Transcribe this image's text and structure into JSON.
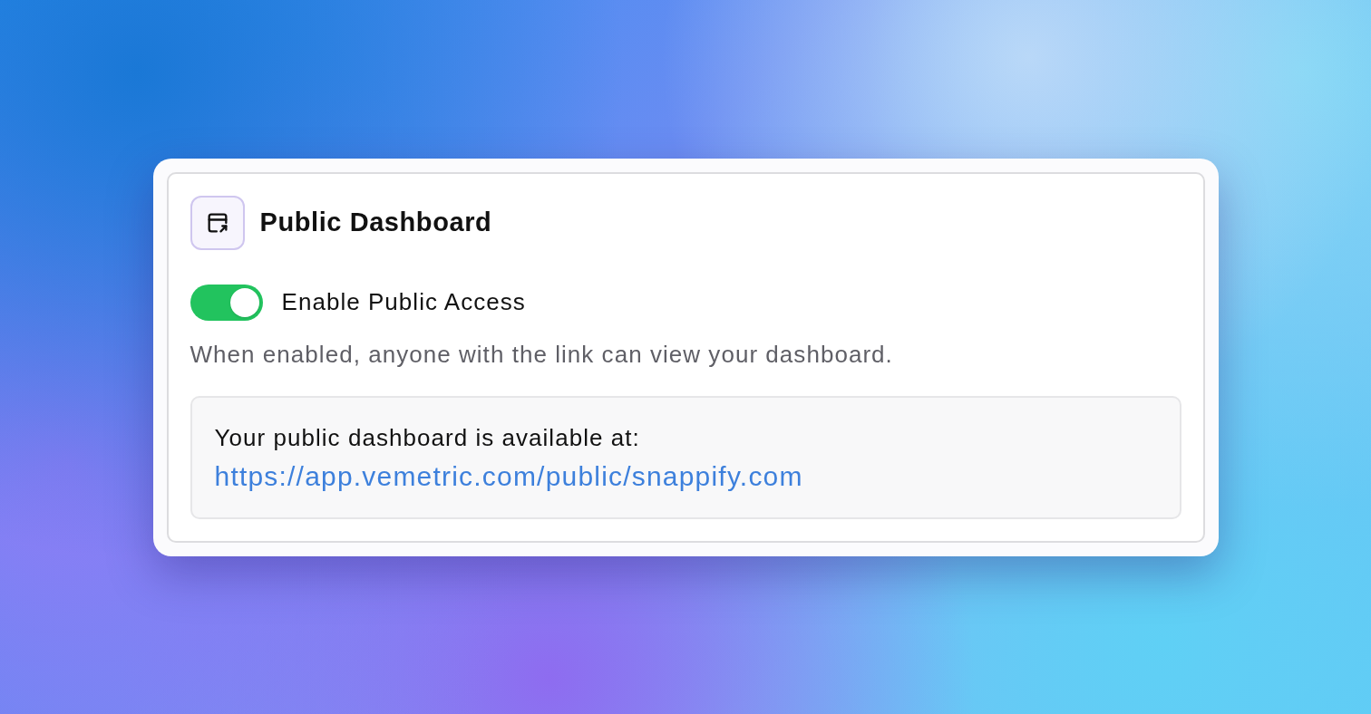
{
  "card": {
    "title": "Public Dashboard"
  },
  "public_access": {
    "label": "Enable Public Access",
    "on": true,
    "description": "When enabled, anyone with the link can view your dashboard."
  },
  "link_box": {
    "text": "Your public dashboard is available at:",
    "url": "https://app.vemetric.com/public/snappify.com"
  }
}
